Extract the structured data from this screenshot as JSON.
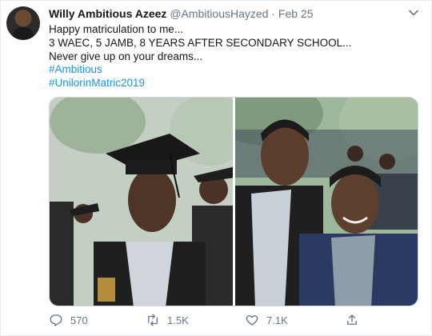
{
  "tweet": {
    "author_name": "Willy Ambitious Azeez",
    "handle": "@AmbitiousHayzed",
    "separator": "·",
    "date": "Feb 25",
    "lines": [
      "Happy matriculation to me...",
      "3 WAEC, 5 JAMB, 8 YEARS AFTER SECONDARY SCHOOL...",
      "Never give up on your dreams..."
    ],
    "hashtags": [
      "#Ambitious",
      "#UnilorinMatric2019"
    ]
  },
  "actions": {
    "reply_count": "570",
    "retweet_count": "1.5K",
    "like_count": "7.1K"
  },
  "icons": {
    "menu": "chevron-down-icon",
    "reply": "reply-icon",
    "retweet": "retweet-icon",
    "like": "heart-icon",
    "share": "share-icon"
  },
  "colors": {
    "link": "#1b95e0",
    "muted": "#657786",
    "text": "#14171a"
  }
}
